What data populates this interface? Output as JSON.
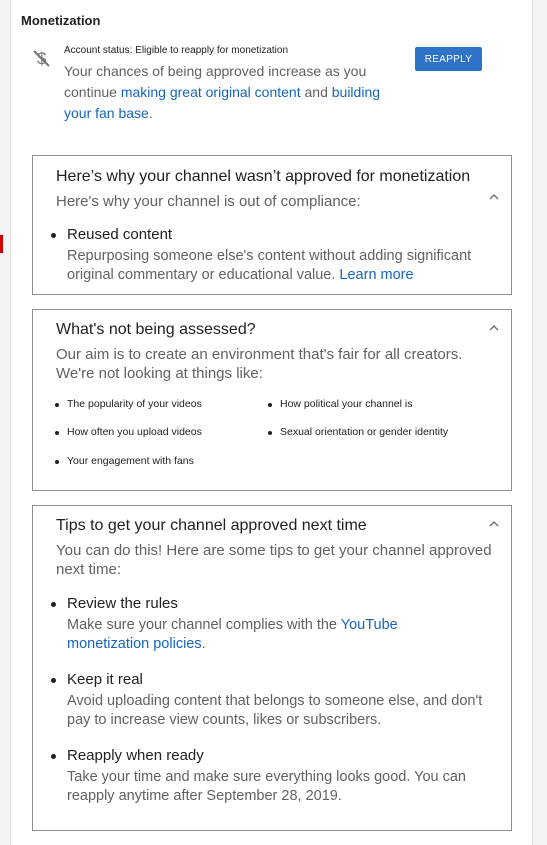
{
  "monetization": {
    "title": "Monetization",
    "account_status": "Account status: Eligible to reapply for monetization",
    "status_text_before": "Your chances of being approved increase as you continue ",
    "link_original_content": "making great original content",
    "status_text_middle": " and ",
    "link_fan_base": "building your fan base",
    "status_text_end": ".",
    "reapply_label": "REAPPLY",
    "status_icon": "no-monetization-dollar-icon"
  },
  "why_not_approved": {
    "title": "Here’s why your channel wasn’t approved for monetization",
    "subtitle": "Here's why your channel is out of compliance:",
    "items": [
      {
        "title": "Reused content",
        "desc_before": "Repurposing someone else's content without adding significant original commentary or educational value. ",
        "link": "Learn more"
      }
    ]
  },
  "not_assessed": {
    "title": "What's not being assessed?",
    "subtitle": "Our aim is to create an environment that's fair for all creators. We're not looking at things like:",
    "items": [
      "The popularity of your videos",
      "How political your channel is",
      "How often you upload videos",
      "Sexual orientation or gender identity",
      "Your engagement with fans"
    ]
  },
  "tips": {
    "title": "Tips to get your channel approved next time",
    "subtitle": "You can do this! Here are some tips to get your channel approved next time:",
    "items": [
      {
        "title": "Review the rules",
        "desc_before": "Make sure your channel complies with the ",
        "link": "YouTube monetization policies",
        "desc_after": "."
      },
      {
        "title": "Keep it real",
        "desc": "Avoid uploading content that belongs to someone else, and don't pay to increase view counts, likes or subscribers."
      },
      {
        "title": "Reapply when ready",
        "desc": "Take your time and make sure everything looks good. You can reapply anytime after September 28, 2019."
      }
    ]
  },
  "colors": {
    "accent": "#2f73c8",
    "link": "#1565c0",
    "indicator": "#cc0000"
  }
}
